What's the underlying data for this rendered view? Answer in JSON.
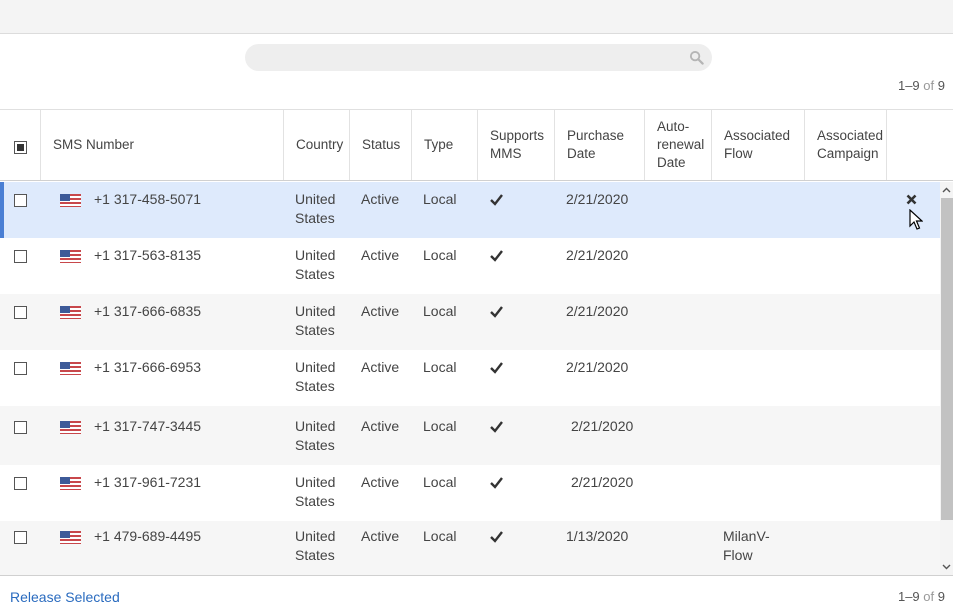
{
  "search": {
    "placeholder": "",
    "value": ""
  },
  "pager": {
    "range": "1–9",
    "of": "of",
    "total": "9"
  },
  "columns": {
    "sms_number": "SMS Number",
    "country": "Country",
    "status": "Status",
    "type": "Type",
    "supports_mms_1": "Supports",
    "supports_mms_2": "MMS",
    "purchase_date_1": "Purchase",
    "purchase_date_2": "Date",
    "autorenewal_1": "Auto-",
    "autorenewal_2": "renewal",
    "autorenewal_3": "Date",
    "assoc_flow_1": "Associated",
    "assoc_flow_2": "Flow",
    "assoc_campaign_1": "Associated",
    "assoc_campaign_2": "Campaign"
  },
  "rows": [
    {
      "number": "+1 317-458-5071",
      "country1": "United",
      "country2": "States",
      "status": "Active",
      "type": "Local",
      "mms": "✔",
      "purchase": "2/21/2020",
      "flow1": "",
      "flow2": "",
      "selected": true
    },
    {
      "number": "+1 317-563-8135",
      "country1": "United",
      "country2": "States",
      "status": "Active",
      "type": "Local",
      "mms": "✔",
      "purchase": "2/21/2020",
      "flow1": "",
      "flow2": ""
    },
    {
      "number": "+1 317-666-6835",
      "country1": "United",
      "country2": "States",
      "status": "Active",
      "type": "Local",
      "mms": "✔",
      "purchase": "2/21/2020",
      "flow1": "",
      "flow2": ""
    },
    {
      "number": "+1 317-666-6953",
      "country1": "United",
      "country2": "States",
      "status": "Active",
      "type": "Local",
      "mms": "✔",
      "purchase": "2/21/2020",
      "flow1": "",
      "flow2": ""
    },
    {
      "number": "+1 317-747-3445",
      "country1": "United",
      "country2": "States",
      "status": "Active",
      "type": "Local",
      "mms": "✔",
      "purchase": "2/21/2020",
      "flow1": "",
      "flow2": ""
    },
    {
      "number": "+1 317-961-7231",
      "country1": "United",
      "country2": "States",
      "status": "Active",
      "type": "Local",
      "mms": "✔",
      "purchase": "2/21/2020",
      "flow1": "",
      "flow2": ""
    },
    {
      "number": "+1 479-689-4495",
      "country1": "United",
      "country2": "States",
      "status": "Active",
      "type": "Local",
      "mms": "✔",
      "purchase": "1/13/2020",
      "flow1": "MilanV-",
      "flow2": "Flow"
    }
  ],
  "footer": {
    "release_label": "Release Selected"
  },
  "icons": {
    "search": "search-icon",
    "flag": "us-flag-icon",
    "check": "check-icon",
    "close": "close-icon",
    "scroll_up": "chevron-up-icon",
    "scroll_down": "chevron-down-icon"
  },
  "colors": {
    "link": "#2a6bbf",
    "selected_row": "#deeafc",
    "selected_accent": "#4a7fd4"
  }
}
